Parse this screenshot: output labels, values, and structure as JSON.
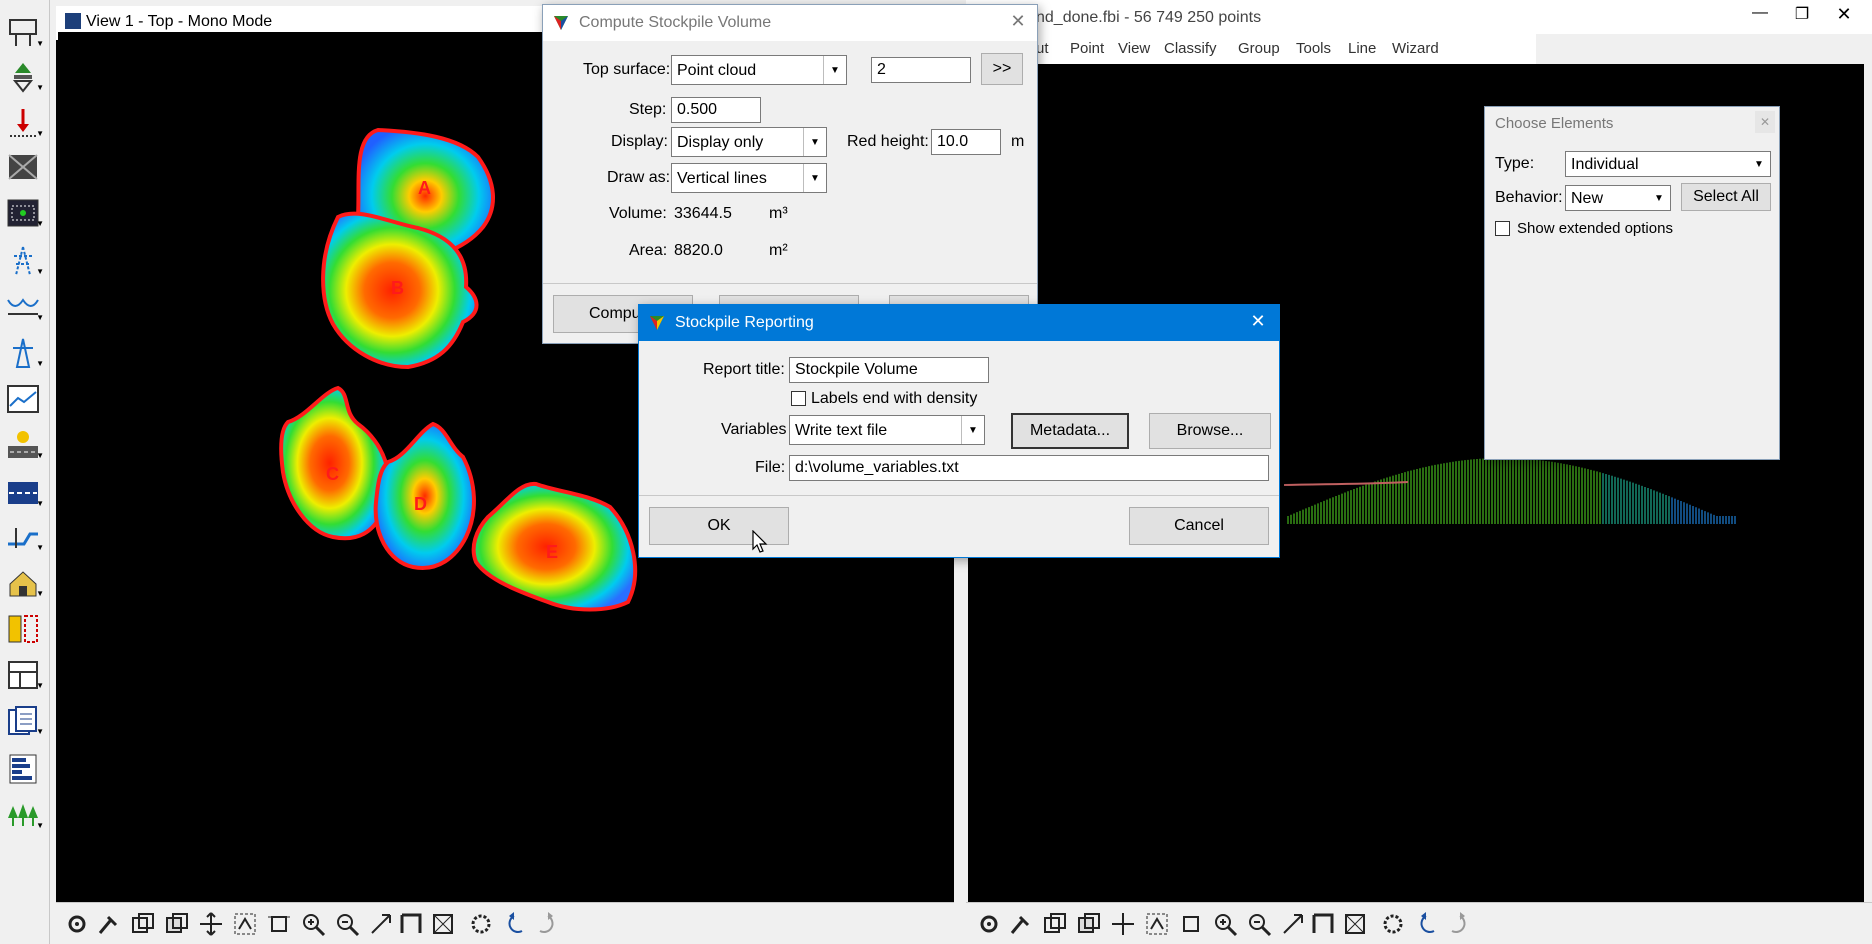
{
  "view1": {
    "title": "View 1 - Top - Mono Mode"
  },
  "main_window": {
    "title": "nd_done.fbi - 56 749 250 points",
    "menu": [
      "ut",
      "Point",
      "View",
      "Classify",
      "Group",
      "Tools",
      "Line",
      "Wizard"
    ]
  },
  "stockpile_labels": [
    "A",
    "B",
    "C",
    "D",
    "E"
  ],
  "compute_dialog": {
    "title": "Compute Stockpile Volume",
    "top_surface_label": "Top surface:",
    "top_surface_value": "Point cloud",
    "top_surface_number": "2",
    "more_button": ">>",
    "step_label": "Step:",
    "step_value": "0.500",
    "display_label": "Display:",
    "display_value": "Display only",
    "red_height_label": "Red height:",
    "red_height_value": "10.0",
    "red_height_unit": "m",
    "draw_as_label": "Draw as:",
    "draw_as_value": "Vertical lines",
    "volume_label": "Volume:",
    "volume_value": "33644.5",
    "volume_unit": "m³",
    "area_label": "Area:",
    "area_value": "8820.0",
    "area_unit": "m²",
    "compute_button": "Compu"
  },
  "choose_elements": {
    "title": "Choose Elements",
    "type_label": "Type:",
    "type_value": "Individual",
    "behavior_label": "Behavior:",
    "behavior_value": "New",
    "select_all_button": "Select All",
    "show_extended_label": "Show extended options",
    "show_extended_checked": false
  },
  "reporting_dialog": {
    "title": "Stockpile Reporting",
    "report_title_label": "Report title:",
    "report_title_value": "Stockpile Volume",
    "labels_density_label": "Labels end with density",
    "labels_density_checked": false,
    "variables_label": "Variables",
    "variables_value": "Write text file",
    "metadata_button": "Metadata...",
    "browse_button": "Browse...",
    "file_label": "File:",
    "file_value": "d:\\volume_variables.txt",
    "ok_button": "OK",
    "cancel_button": "Cancel"
  },
  "colors": {
    "dialog_title_active": "#0078d7",
    "dialog_bg": "#f0f0f0",
    "view_bg": "#000000",
    "outline": "#ff1a1a"
  }
}
